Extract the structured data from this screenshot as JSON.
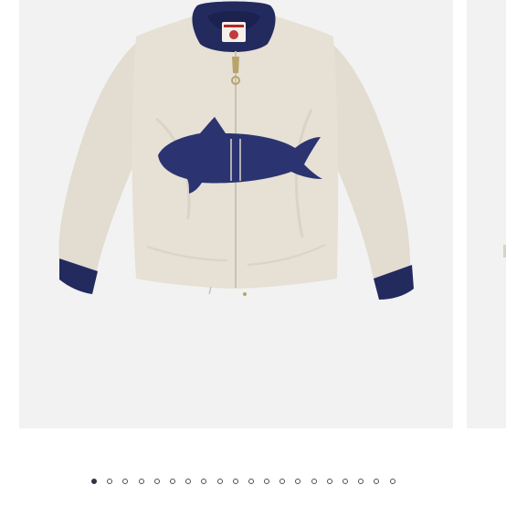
{
  "carousel": {
    "current_slide": 1,
    "slide_count": 20,
    "current_image": {
      "subject": "jacket-photo",
      "body_color": "#e4ded3",
      "trim_color": "#232a5e",
      "fish_color": "#2b3470"
    },
    "next_image": {
      "subject": "next-photo-partial"
    },
    "colors": {
      "slide_bg": "#f2f2f2",
      "dot": "#4b4f5a",
      "dot_active": "#2f3440"
    }
  }
}
